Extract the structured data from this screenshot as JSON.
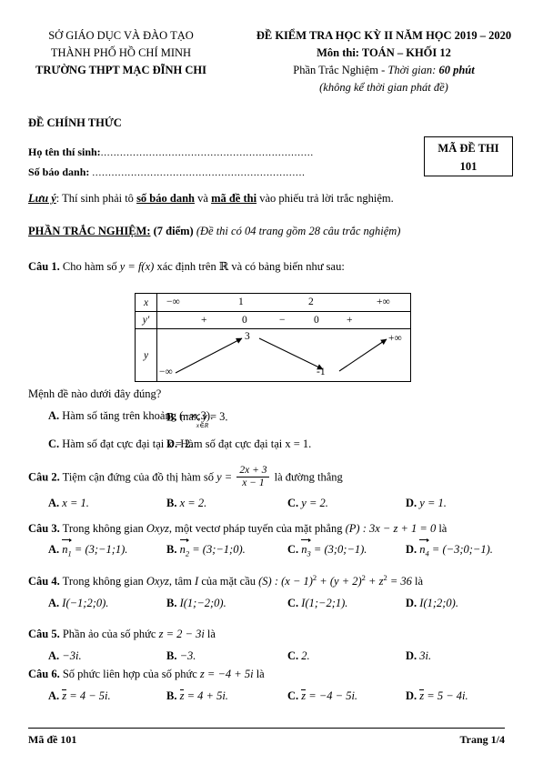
{
  "header": {
    "left_line1": "SỞ GIÁO DỤC VÀ ĐÀO TẠO",
    "left_line2": "THÀNH PHỐ HỒ CHÍ MINH",
    "left_line3": "TRƯỜNG THPT MẠC ĐĨNH CHI",
    "right_line1": "ĐỀ KIỂM TRA HỌC KỲ II NĂM HỌC 2019 – 2020",
    "right_line2": "Môn thi: TOÁN – KHỐI 12",
    "right_line3_a": "Phần Trắc Nghiệm - ",
    "right_line3_b": "Thời gian: ",
    "right_line3_c": "60 phút",
    "right_line4": "(không kể thời gian phát đề)",
    "official": "ĐỀ CHÍNH THỨC"
  },
  "fields": {
    "name_label": "Họ tên thí sinh:",
    "name_dots": "..................................................................",
    "id_label": "Số báo danh: ",
    "id_dots": ".................................................................."
  },
  "code_box": {
    "title": "MÃ ĐỀ THI",
    "code": "101"
  },
  "note": {
    "prefix": "Lưu ý",
    "part1": ": Thí sinh phải tô ",
    "em1": "số báo danh",
    "part2": " và ",
    "em2": "mã đề thi",
    "part3": " vào phiếu trả lời trắc nghiệm."
  },
  "section": {
    "title": "PHẦN TRẮC NGHIỆM:",
    "points": " (7 điểm) ",
    "desc": "(Đề thi có 04 trang gồm 28 câu trắc nghiệm)"
  },
  "variation_table": {
    "row_labels": [
      "x",
      "y'",
      "y"
    ],
    "x_values": [
      "−∞",
      "1",
      "2",
      "+∞"
    ],
    "yprime_signs": [
      "+",
      "0",
      "−",
      "0",
      "+"
    ],
    "y_values": [
      "−∞",
      "3",
      "-1",
      "+∞"
    ]
  },
  "questions": [
    {
      "number": "Câu 1.",
      "stem_a": " Cho hàm số ",
      "stem_math": "y = f(x)",
      "stem_b": " xác định trên ",
      "stem_R": "ℝ",
      "stem_c": " và có bảng biến như sau:",
      "prompt": "Mệnh đề nào dưới đây đúng?",
      "options": [
        {
          "key": "A.",
          "text": "Hàm số tăng trên khoảng (−∞;3)."
        },
        {
          "key": "B.",
          "text": "max y = 3",
          "max_sub": "x∈R",
          "tail": "."
        },
        {
          "key": "C.",
          "text": "Hàm số đạt cực đại tại x = 2."
        },
        {
          "key": "D.",
          "text": "Hàm số đạt cực đại tại x = 1."
        }
      ]
    },
    {
      "number": "Câu 2.",
      "stem_a": " Tiệm cận đứng của đồ thị hàm số ",
      "stem_y": "y = ",
      "frac_num": "2x + 3",
      "frac_den": "x − 1",
      "stem_b": " là đường thẳng",
      "options": [
        {
          "key": "A.",
          "text": "x = 1."
        },
        {
          "key": "B.",
          "text": "x = 2."
        },
        {
          "key": "C.",
          "text": "y = 2."
        },
        {
          "key": "D.",
          "text": "y = 1."
        }
      ]
    },
    {
      "number": "Câu 3.",
      "stem_a": " Trong không gian ",
      "stem_oxyz": "Oxyz",
      "stem_b": ", một vectơ pháp tuyến của mặt phẳng ",
      "stem_plane": "(P) : 3x − z + 1 = 0",
      "stem_c": " là",
      "options": [
        {
          "key": "A.",
          "vec": "n",
          "sub": "1",
          "text": " = (3;−1;1)."
        },
        {
          "key": "B.",
          "vec": "n",
          "sub": "2",
          "text": " = (3;−1;0)."
        },
        {
          "key": "C.",
          "vec": "n",
          "sub": "3",
          "text": " = (3;0;−1)."
        },
        {
          "key": "D.",
          "vec": "n",
          "sub": "4",
          "text": " = (−3;0;−1)."
        }
      ]
    },
    {
      "number": "Câu 4.",
      "stem_a": " Trong không gian ",
      "stem_oxyz": "Oxyz",
      "stem_b": ", tâm ",
      "stem_I": "I",
      "stem_c": " của mặt cầu ",
      "stem_sphere_pre": "(S) : (x − 1)",
      "stem_sup1": "2",
      "stem_sphere_mid": " + (y + 2)",
      "stem_sup2": "2",
      "stem_sphere_mid2": " + z",
      "stem_sup3": "2",
      "stem_sphere_end": " = 36",
      "stem_d": " là",
      "options": [
        {
          "key": "A.",
          "text": "I(−1;2;0)."
        },
        {
          "key": "B.",
          "text": "I(1;−2;0)."
        },
        {
          "key": "C.",
          "text": "I(1;−2;1)."
        },
        {
          "key": "D.",
          "text": "I(1;2;0)."
        }
      ]
    },
    {
      "number": "Câu 5.",
      "stem_a": " Phần ảo của số phức ",
      "stem_math": "z = 2 − 3i",
      "stem_b": " là",
      "options": [
        {
          "key": "A.",
          "text": "−3i."
        },
        {
          "key": "B.",
          "text": "−3."
        },
        {
          "key": "C.",
          "text": "2."
        },
        {
          "key": "D.",
          "text": "3i."
        }
      ]
    },
    {
      "number": "Câu 6.",
      "stem_a": " Số phức liên hợp của số phức ",
      "stem_math": "z = −4 + 5i",
      "stem_b": " là",
      "options": [
        {
          "key": "A.",
          "conj": "z",
          "text": " = 4 − 5i."
        },
        {
          "key": "B.",
          "conj": "z",
          "text": " = 4 + 5i."
        },
        {
          "key": "C.",
          "conj": "z",
          "text": " = −4 − 5i."
        },
        {
          "key": "D.",
          "conj": "z",
          "text": " = 5 − 4i."
        }
      ]
    }
  ],
  "footer": {
    "left": "Mã đề 101",
    "right": "Trang 1/4"
  }
}
